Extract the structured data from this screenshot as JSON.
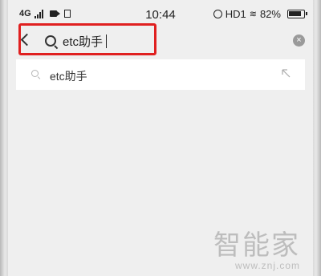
{
  "status_bar": {
    "network": "4G",
    "time": "10:44",
    "hd_label": "HD1",
    "battery_text": "82%",
    "icons": [
      "signal-icon",
      "camera-icon",
      "doc-icon",
      "alarm-icon",
      "wifi-icon",
      "battery-icon"
    ]
  },
  "search": {
    "value": "etc助手",
    "icons": [
      "back-icon",
      "search-icon",
      "clear-icon"
    ],
    "clear_glyph": "×"
  },
  "suggestions": [
    {
      "text": "etc助手",
      "icon": "search-icon",
      "action_icon": "fill-arrow-icon"
    }
  ],
  "watermark": {
    "logo": "智能家",
    "url": "www.znj.com"
  },
  "colors": {
    "highlight": "#e02020",
    "background": "#efefef",
    "list_background": "#ffffff"
  }
}
